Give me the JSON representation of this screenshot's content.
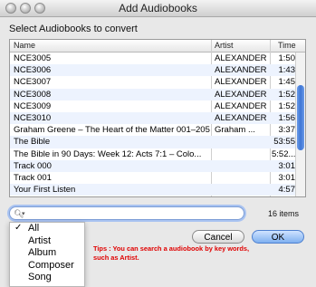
{
  "window": {
    "title": "Add Audiobooks"
  },
  "heading": "Select Audiobooks to convert",
  "table": {
    "columns": {
      "name": "Name",
      "artist": "Artist",
      "time": "Time"
    },
    "rows": [
      {
        "name": "NCE3005",
        "artist": "ALEXANDER",
        "time": "1:50"
      },
      {
        "name": "NCE3006",
        "artist": "ALEXANDER",
        "time": "1:43"
      },
      {
        "name": "NCE3007",
        "artist": "ALEXANDER",
        "time": "1:45"
      },
      {
        "name": "NCE3008",
        "artist": "ALEXANDER",
        "time": "1:52"
      },
      {
        "name": "NCE3009",
        "artist": "ALEXANDER",
        "time": "1:52"
      },
      {
        "name": "NCE3010",
        "artist": "ALEXANDER",
        "time": "1:56"
      },
      {
        "name": "Graham Greene – The Heart of the Matter 001–205",
        "artist": "Graham ...",
        "time": "3:37"
      },
      {
        "name": "The Bible",
        "artist": "",
        "time": "53:55"
      },
      {
        "name": "The Bible in 90 Days: Week 12: Acts 7:1 – Colo...",
        "artist": "",
        "time": "5:52..."
      },
      {
        "name": "Track 000",
        "artist": "",
        "time": "3:01"
      },
      {
        "name": "Track 001",
        "artist": "",
        "time": "3:01"
      },
      {
        "name": "Your First Listen",
        "artist": "",
        "time": "4:57"
      }
    ]
  },
  "search": {
    "value": "",
    "placeholder": ""
  },
  "items_count": "16 items",
  "search_menu": {
    "items": [
      {
        "label": "All",
        "checked": "✓"
      },
      {
        "label": "Artist",
        "checked": ""
      },
      {
        "label": "Album",
        "checked": ""
      },
      {
        "label": "Composer",
        "checked": ""
      },
      {
        "label": "Song",
        "checked": ""
      }
    ]
  },
  "tips": "Tips : You can search a audiobook by key words, such as Artist.",
  "buttons": {
    "cancel": "Cancel",
    "ok": "OK"
  },
  "icons": {
    "search": "magnifier-icon",
    "dropdown": "chevron-down-icon"
  }
}
